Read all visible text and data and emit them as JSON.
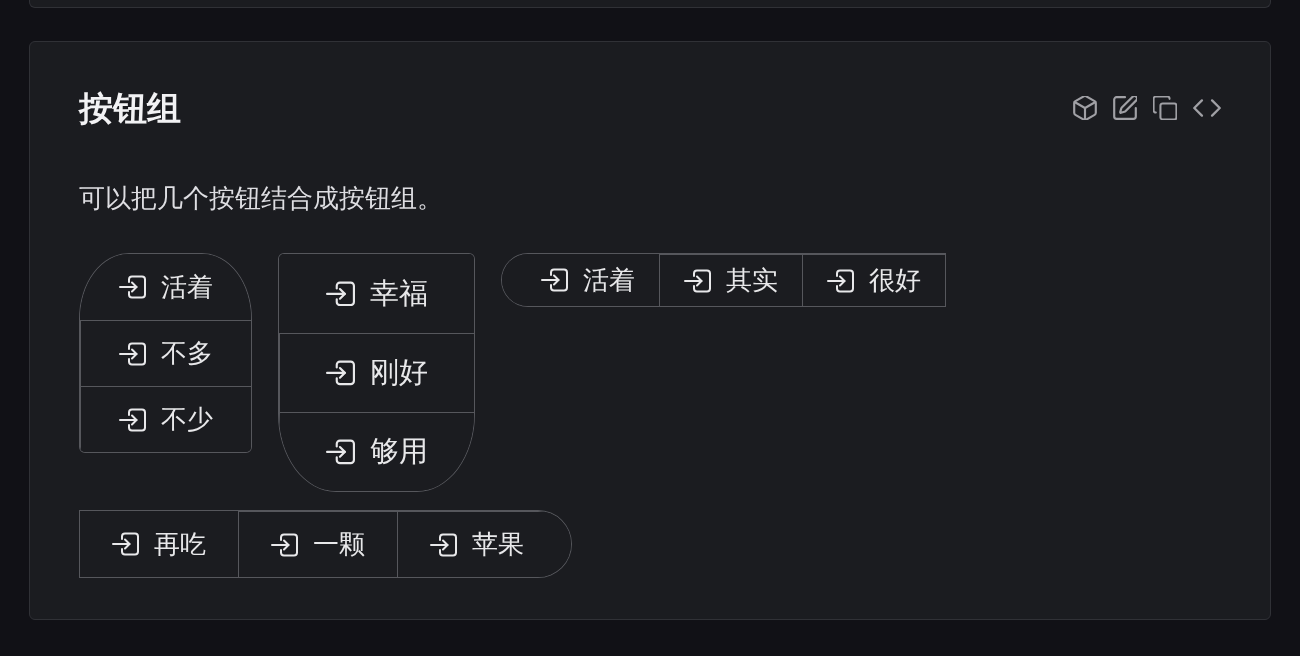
{
  "title": "按钮组",
  "description": "可以把几个按钮结合成按钮组。",
  "button_groups": [
    {
      "kind": "roundtop",
      "buttons": [
        {
          "label": "活着"
        },
        {
          "label": "不多"
        },
        {
          "label": "不少"
        }
      ]
    },
    {
      "kind": "roundbottom",
      "buttons": [
        {
          "label": "幸福"
        },
        {
          "label": "刚好"
        },
        {
          "label": "够用"
        }
      ]
    },
    {
      "kind": "roundleft",
      "buttons": [
        {
          "label": "活着"
        },
        {
          "label": "其实"
        },
        {
          "label": "很好"
        }
      ]
    },
    {
      "kind": "roundright",
      "buttons": [
        {
          "label": "再吃"
        },
        {
          "label": "一颗"
        },
        {
          "label": "苹果"
        }
      ]
    }
  ]
}
